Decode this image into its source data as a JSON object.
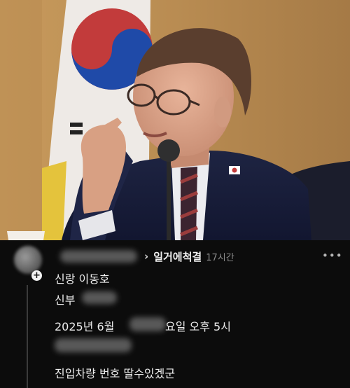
{
  "comment": {
    "reply_target": "일거에척결",
    "time_ago": "17시간",
    "lines": {
      "groom": "신랑 이동호",
      "bride": "신부",
      "date_a": "2025년 6월",
      "date_b": "요일 오후 5시",
      "remark": "진입차량 번호 딸수있겠군"
    }
  },
  "icons": {
    "more": "more-horizontal-icon",
    "chevron": "chevron-right-icon",
    "reply_badge": "plus-icon"
  }
}
